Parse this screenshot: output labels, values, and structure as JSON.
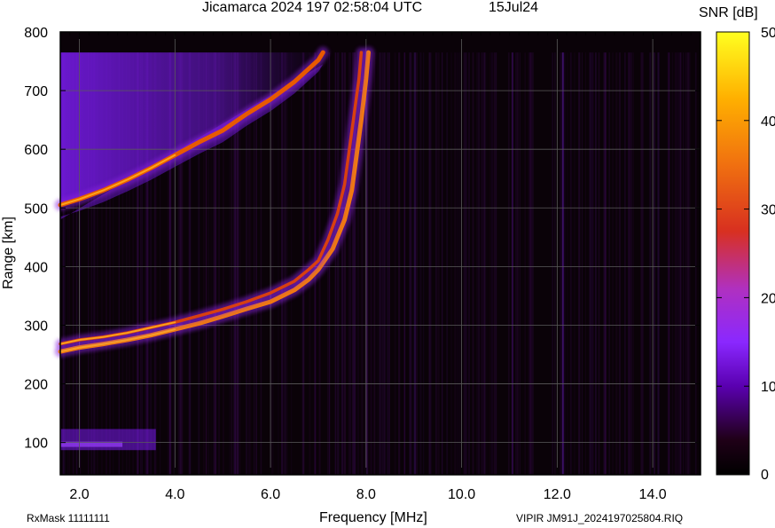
{
  "header": {
    "title": "Jicamarca 2024 197 02:58:04 UTC",
    "date": "15Jul24"
  },
  "footer": {
    "left": "RxMask 11111111",
    "right": "VIPIR  JM91J_2024197025804.RIQ"
  },
  "colors": {
    "background": "#0a0208",
    "frame": "#000000",
    "grid": "#5a5a5a",
    "o_trace": "#f07a10",
    "x_trace": "#e05a00",
    "diffuse": "#7a1cf0",
    "colormap": [
      "#000000",
      "#2a0020",
      "#5a00a0",
      "#8a30ff",
      "#c02890",
      "#e04010",
      "#ff8a00",
      "#ffd000",
      "#ffff20"
    ]
  },
  "chart_data": {
    "type": "heatmap",
    "title": "Jicamarca 2024 197 02:58:04 UTC",
    "xlabel": "Frequency [MHz]",
    "ylabel": "Range [km]",
    "xlim": [
      1.6,
      15.0
    ],
    "ylim": [
      45,
      800
    ],
    "xticks": [
      2.0,
      4.0,
      6.0,
      8.0,
      10.0,
      12.0,
      14.0
    ],
    "xtick_labels": [
      "2.0",
      "4.0",
      "6.0",
      "8.0",
      "10.0",
      "12.0",
      "14.0"
    ],
    "yticks": [
      100,
      200,
      300,
      400,
      500,
      600,
      700,
      800
    ],
    "ytick_labels": [
      "100",
      "200",
      "300",
      "400",
      "500",
      "600",
      "700",
      "800"
    ],
    "grid": true,
    "colorbar": {
      "label": "SNR [dB]",
      "range": [
        0,
        50
      ],
      "ticks": [
        0,
        10,
        20,
        30,
        40,
        50
      ],
      "tick_labels": [
        "0",
        "10",
        "20",
        "30",
        "40",
        "50"
      ]
    },
    "series": [
      {
        "points": [
          [
            1.6,
            255
          ],
          [
            2.0,
            262
          ],
          [
            2.5,
            268
          ],
          [
            3.0,
            275
          ],
          [
            3.5,
            283
          ],
          [
            4.0,
            293
          ],
          [
            4.5,
            303
          ],
          [
            5.0,
            315
          ],
          [
            5.5,
            328
          ],
          [
            6.0,
            340
          ],
          [
            6.5,
            360
          ],
          [
            6.8,
            378
          ],
          [
            7.0,
            395
          ],
          [
            7.3,
            430
          ],
          [
            7.55,
            480
          ],
          [
            7.7,
            530
          ],
          [
            7.8,
            590
          ],
          [
            7.9,
            650
          ],
          [
            8.0,
            720
          ],
          [
            8.05,
            765
          ]
        ]
      },
      {
        "points": [
          [
            1.6,
            505
          ],
          [
            2.0,
            515
          ],
          [
            2.5,
            530
          ],
          [
            3.0,
            548
          ],
          [
            3.5,
            568
          ],
          [
            4.0,
            590
          ],
          [
            4.5,
            612
          ],
          [
            5.0,
            632
          ],
          [
            5.5,
            660
          ],
          [
            6.0,
            685
          ],
          [
            6.5,
            715
          ],
          [
            7.0,
            752
          ],
          [
            7.1,
            765
          ]
        ]
      },
      {
        "points": [
          [
            1.6,
            268
          ],
          [
            2.0,
            275
          ],
          [
            2.5,
            280
          ],
          [
            3.0,
            287
          ],
          [
            3.5,
            296
          ],
          [
            4.0,
            305
          ],
          [
            4.5,
            316
          ],
          [
            5.0,
            327
          ],
          [
            5.5,
            340
          ],
          [
            6.0,
            355
          ],
          [
            6.5,
            375
          ],
          [
            6.8,
            395
          ],
          [
            7.0,
            410
          ],
          [
            7.2,
            445
          ],
          [
            7.4,
            490
          ],
          [
            7.55,
            540
          ],
          [
            7.65,
            600
          ],
          [
            7.75,
            660
          ],
          [
            7.85,
            720
          ],
          [
            7.9,
            765
          ]
        ]
      }
    ],
    "sporadic_layer": {
      "range_km": 95,
      "freq_mhz": [
        1.6,
        3.6
      ]
    },
    "spread_echo": {
      "range_km": [
        500,
        765
      ],
      "freq_mhz": [
        1.6,
        7.2
      ]
    }
  }
}
